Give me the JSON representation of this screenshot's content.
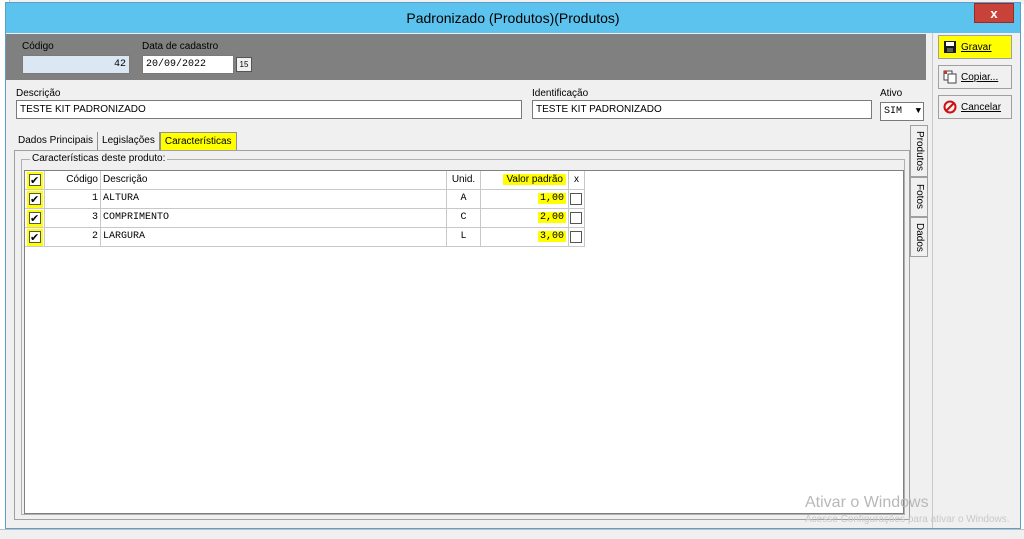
{
  "window": {
    "title": "Padronizado (Produtos)(Produtos)",
    "close_label": "x"
  },
  "side_buttons": {
    "gravar": "Gravar",
    "copiar": "Copiar...",
    "cancelar": "Cancelar"
  },
  "header": {
    "codigo_label": "Código",
    "codigo_value": "42",
    "data_label": "Data de cadastro",
    "data_value": "20/09/2022",
    "calendar_glyph": "15"
  },
  "descricao": {
    "label": "Descrição",
    "value": "TESTE KIT PADRONIZADO"
  },
  "identificacao": {
    "label": "Identificação",
    "value": "TESTE KIT PADRONIZADO"
  },
  "ativo": {
    "label": "Ativo",
    "value": "SIM"
  },
  "tabs": [
    "Dados Principais",
    "Legislações",
    "Características"
  ],
  "vertical_tabs": [
    "Produtos",
    "Fotos",
    "Dados"
  ],
  "group": {
    "title": "Características deste produto:"
  },
  "grid": {
    "headers": {
      "codigo": "Código",
      "descricao": "Descrição",
      "unid": "Unid.",
      "valor": "Valor padrão",
      "x": "x"
    },
    "rows": [
      {
        "checked": true,
        "codigo": "1",
        "descricao": "ALTURA",
        "unid": "A",
        "valor": "1,00",
        "x": false
      },
      {
        "checked": true,
        "codigo": "3",
        "descricao": "COMPRIMENTO",
        "unid": "C",
        "valor": "2,00",
        "x": false
      },
      {
        "checked": true,
        "codigo": "2",
        "descricao": "LARGURA",
        "unid": "L",
        "valor": "3,00",
        "x": false
      }
    ]
  },
  "watermark": {
    "line1": "Ativar o Windows",
    "line2": "Acesse Configurações para ativar o Windows."
  },
  "colors": {
    "titlebar": "#5bc3ee",
    "highlight": "#ffff00",
    "header_band": "#808080",
    "close": "#c9423a"
  }
}
